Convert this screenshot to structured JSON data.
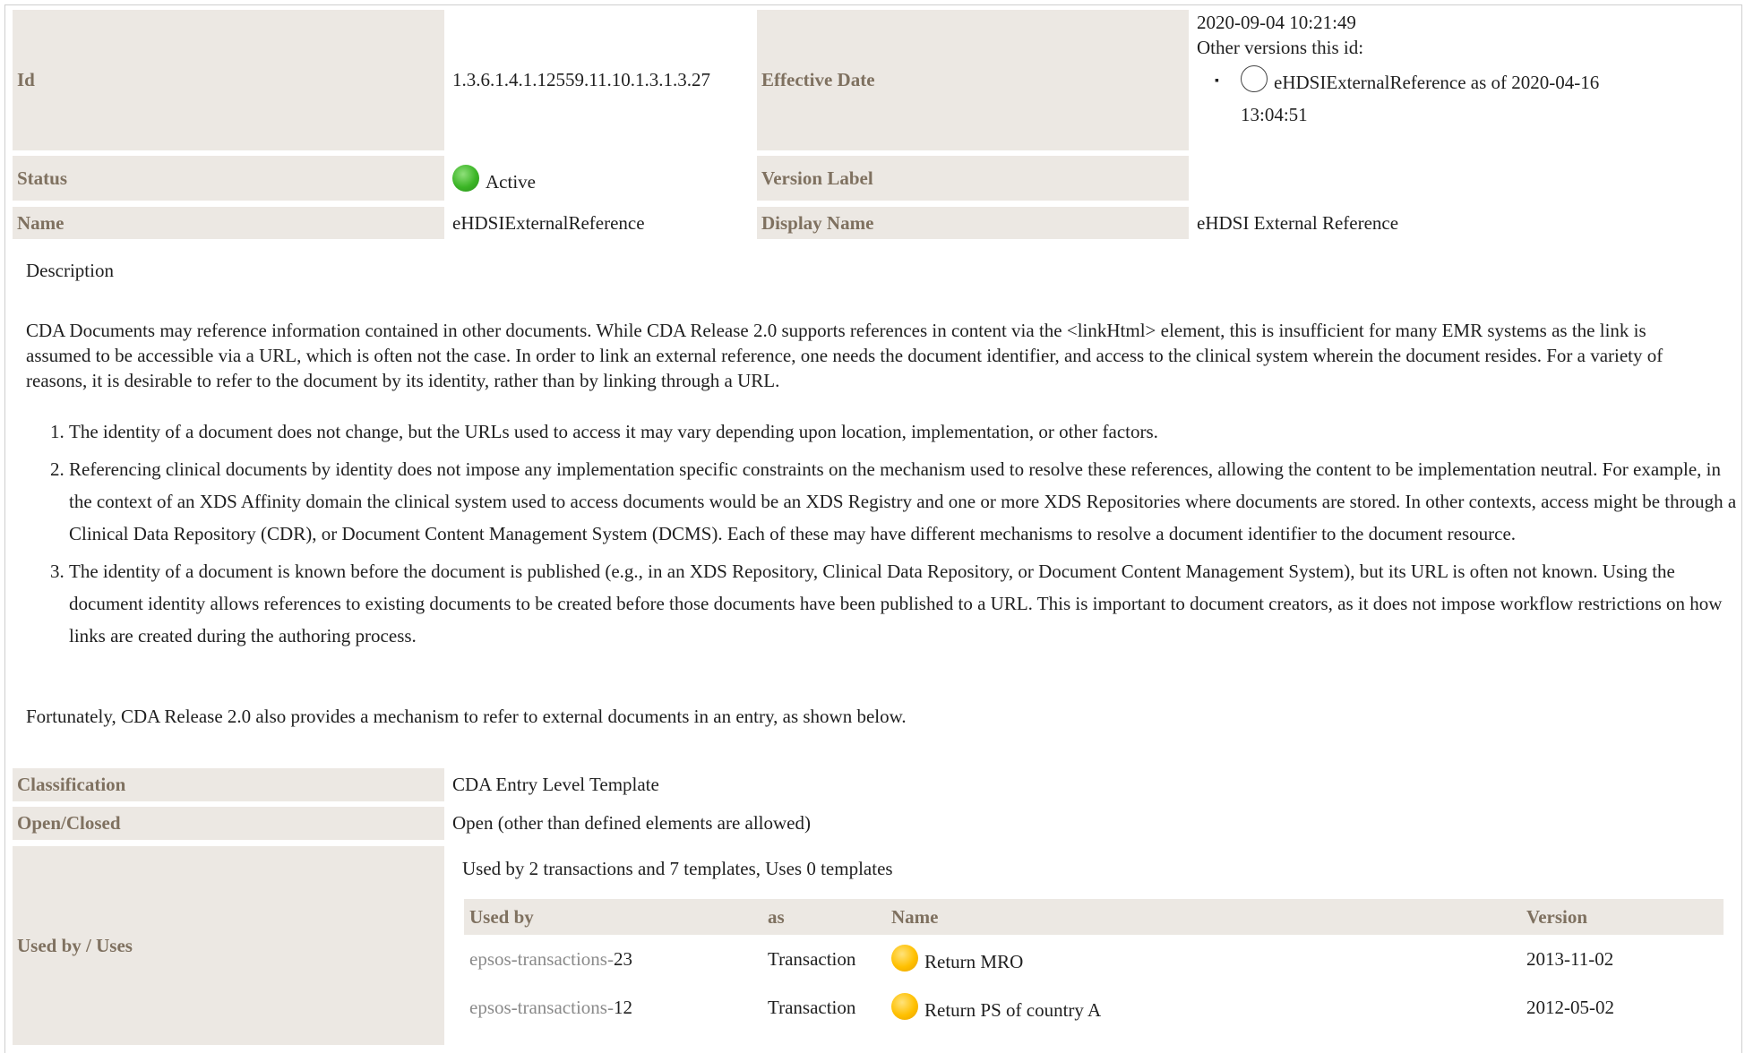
{
  "header": {
    "id_label": "Id",
    "id_value": "1.3.6.1.4.1.12559.11.10.1.3.1.3.27",
    "effective_date_label": "Effective Date",
    "effective_date_value": "2020-09-04 10:21:49",
    "other_versions_label": "Other versions this id:",
    "other_versions": [
      {
        "line1": "eHDSIExternalReference as of 2020-04-16",
        "line2": "13:04:51"
      }
    ],
    "status_label": "Status",
    "status_value": "Active",
    "version_label_label": "Version Label",
    "version_label_value": "",
    "name_label": "Name",
    "name_value": "eHDSIExternalReference",
    "display_name_label": "Display Name",
    "display_name_value": "eHDSI External Reference"
  },
  "description": {
    "label": "Description",
    "intro": "CDA Documents may reference information contained in other documents. While CDA Release 2.0 supports references in content via the <linkHtml> element, this is insufficient for many EMR systems as the link is assumed to be accessible via a URL, which is often not the case. In order to link an external reference, one needs the document identifier, and access to the clinical system wherein the document resides. For a variety of reasons, it is desirable to refer to the document by its identity, rather than by linking through a URL.",
    "reasons": [
      "The identity of a document does not change, but the URLs used to access it may vary depending upon location, implementation, or other factors.",
      "Referencing clinical documents by identity does not impose any implementation specific constraints on the mechanism used to resolve these references, allowing the content to be implementation neutral. For example, in the context of an XDS Affinity domain the clinical system used to access documents would be an XDS Registry and one or more XDS Repositories where documents are stored. In other contexts, access might be through a Clinical Data Repository (CDR), or Document Content Management System (DCMS). Each of these may have different mechanisms to resolve a document identifier to the document resource.",
      "The identity of a document is known before the document is published (e.g., in an XDS Repository, Clinical Data Repository, or Document Content Management System), but its URL is often not known. Using the document identity allows references to existing documents to be created before those documents have been published to a URL. This is important to document creators, as it does not impose workflow restrictions on how links are created during the authoring process."
    ],
    "outro": "Fortunately, CDA Release 2.0 also provides a mechanism to refer to external documents in an entry, as shown below."
  },
  "details": {
    "classification_label": "Classification",
    "classification_value": "CDA Entry Level Template",
    "open_closed_label": "Open/Closed",
    "open_closed_value": "Open (other than defined elements are allowed)",
    "used_by_label": "Used by / Uses",
    "used_by_summary": "Used by 2 transactions and 7 templates, Uses 0 templates"
  },
  "usage_table": {
    "columns": [
      "Used by",
      "as",
      "Name",
      "Version"
    ],
    "rows": [
      {
        "ref_prefix": "epsos-transactions-",
        "ref_num": "23",
        "as": "Transaction",
        "name": "Return MRO",
        "version": "2013-11-02"
      },
      {
        "ref_prefix": "epsos-transactions-",
        "ref_num": "12",
        "as": "Transaction",
        "name": "Return PS of country A",
        "version": "2012-05-02"
      }
    ]
  },
  "colors": {
    "label_bg": "#ece8e3",
    "label_text": "#7f7160",
    "status_active": "#3bb526",
    "status_pending": "#ffc000"
  }
}
